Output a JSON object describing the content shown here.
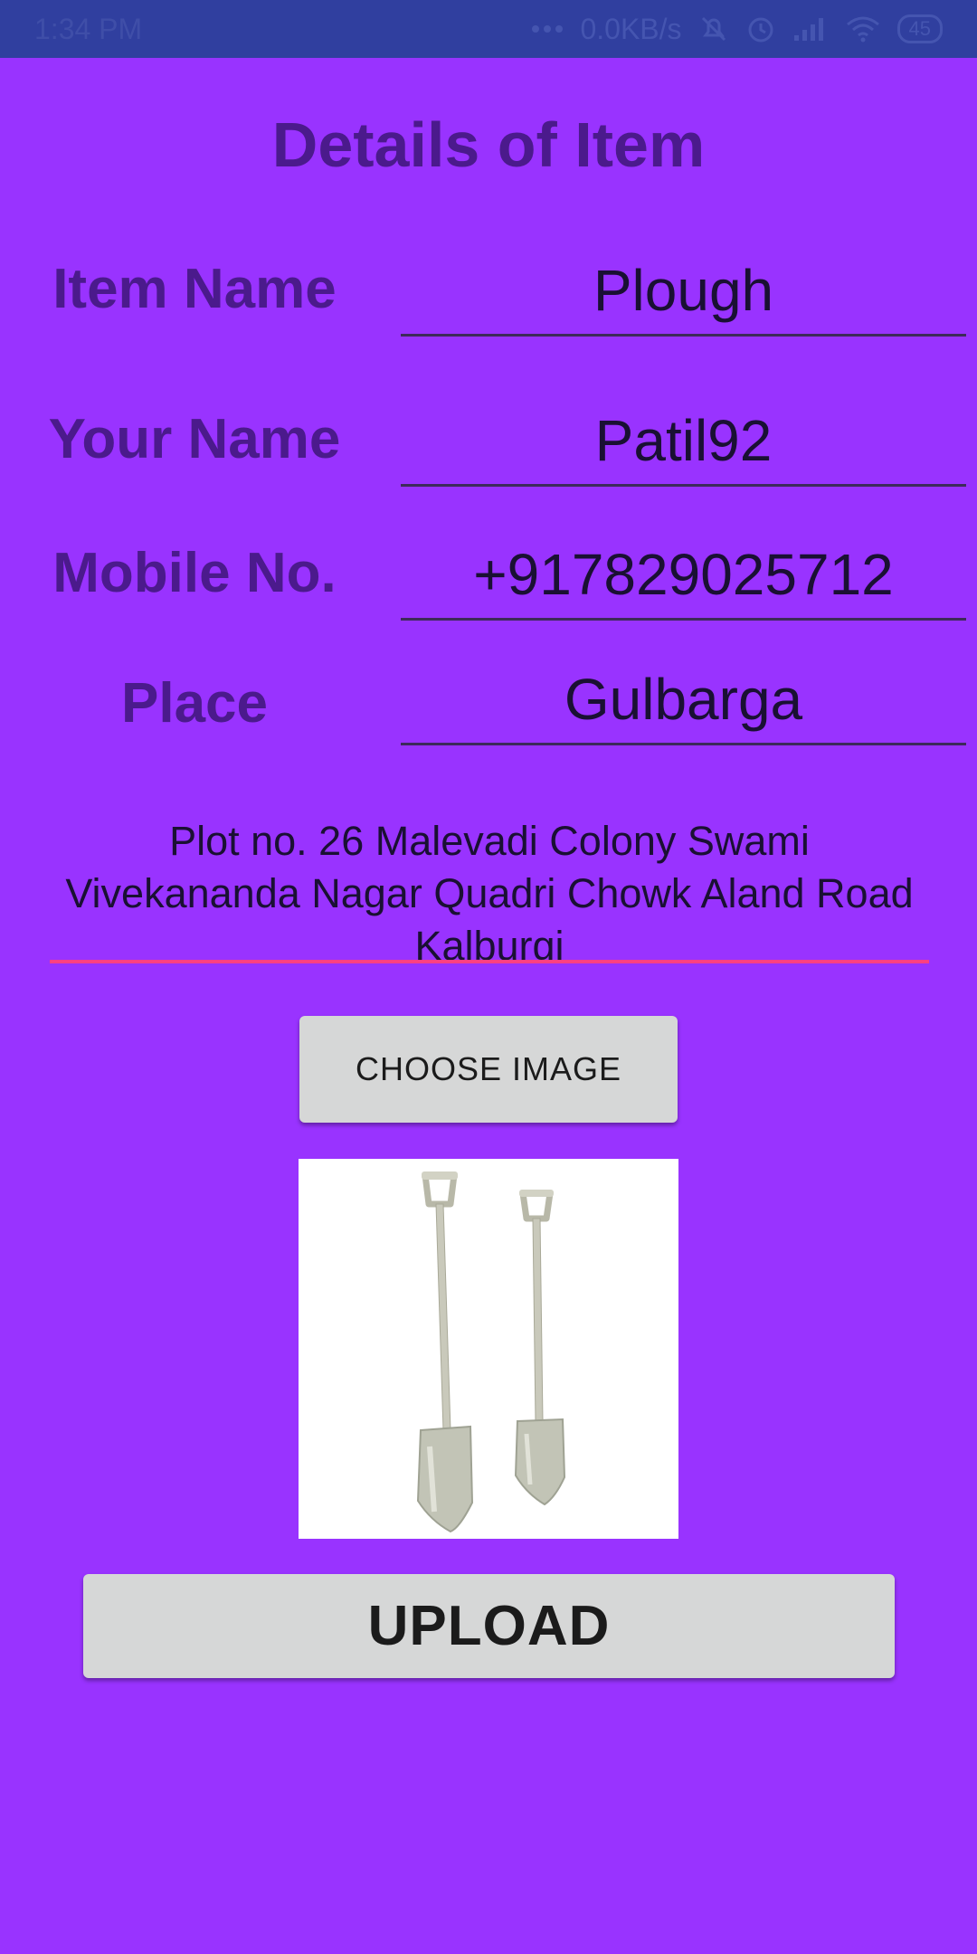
{
  "status_bar": {
    "time": "1:34 PM",
    "network_speed": "0.0KB/s",
    "battery": "45",
    "icons": [
      "more-dots-icon",
      "mute-icon",
      "alarm-icon",
      "signal-icon",
      "wifi-icon",
      "battery-icon"
    ]
  },
  "page": {
    "title": "Details of Item",
    "background_color": "#9933ff",
    "label_color": "#4b1a8c",
    "accent_color": "#ff4081"
  },
  "fields": {
    "item_name": {
      "label": "Item Name",
      "value": "Plough"
    },
    "your_name": {
      "label": "Your Name",
      "value": "Patil92"
    },
    "mobile": {
      "label": "Mobile No.",
      "value": "+917829025712"
    },
    "place": {
      "label": "Place",
      "value": "Gulbarga"
    }
  },
  "address": {
    "value": "Plot no. 26 Malevadi Colony Swami Vivekananda Nagar Quadri Chowk Aland Road Kalburgi"
  },
  "choose_button": {
    "label": "CHOOSE IMAGE"
  },
  "image": {
    "subject": "two-shovels"
  },
  "upload_button": {
    "label": "UPLOAD"
  }
}
